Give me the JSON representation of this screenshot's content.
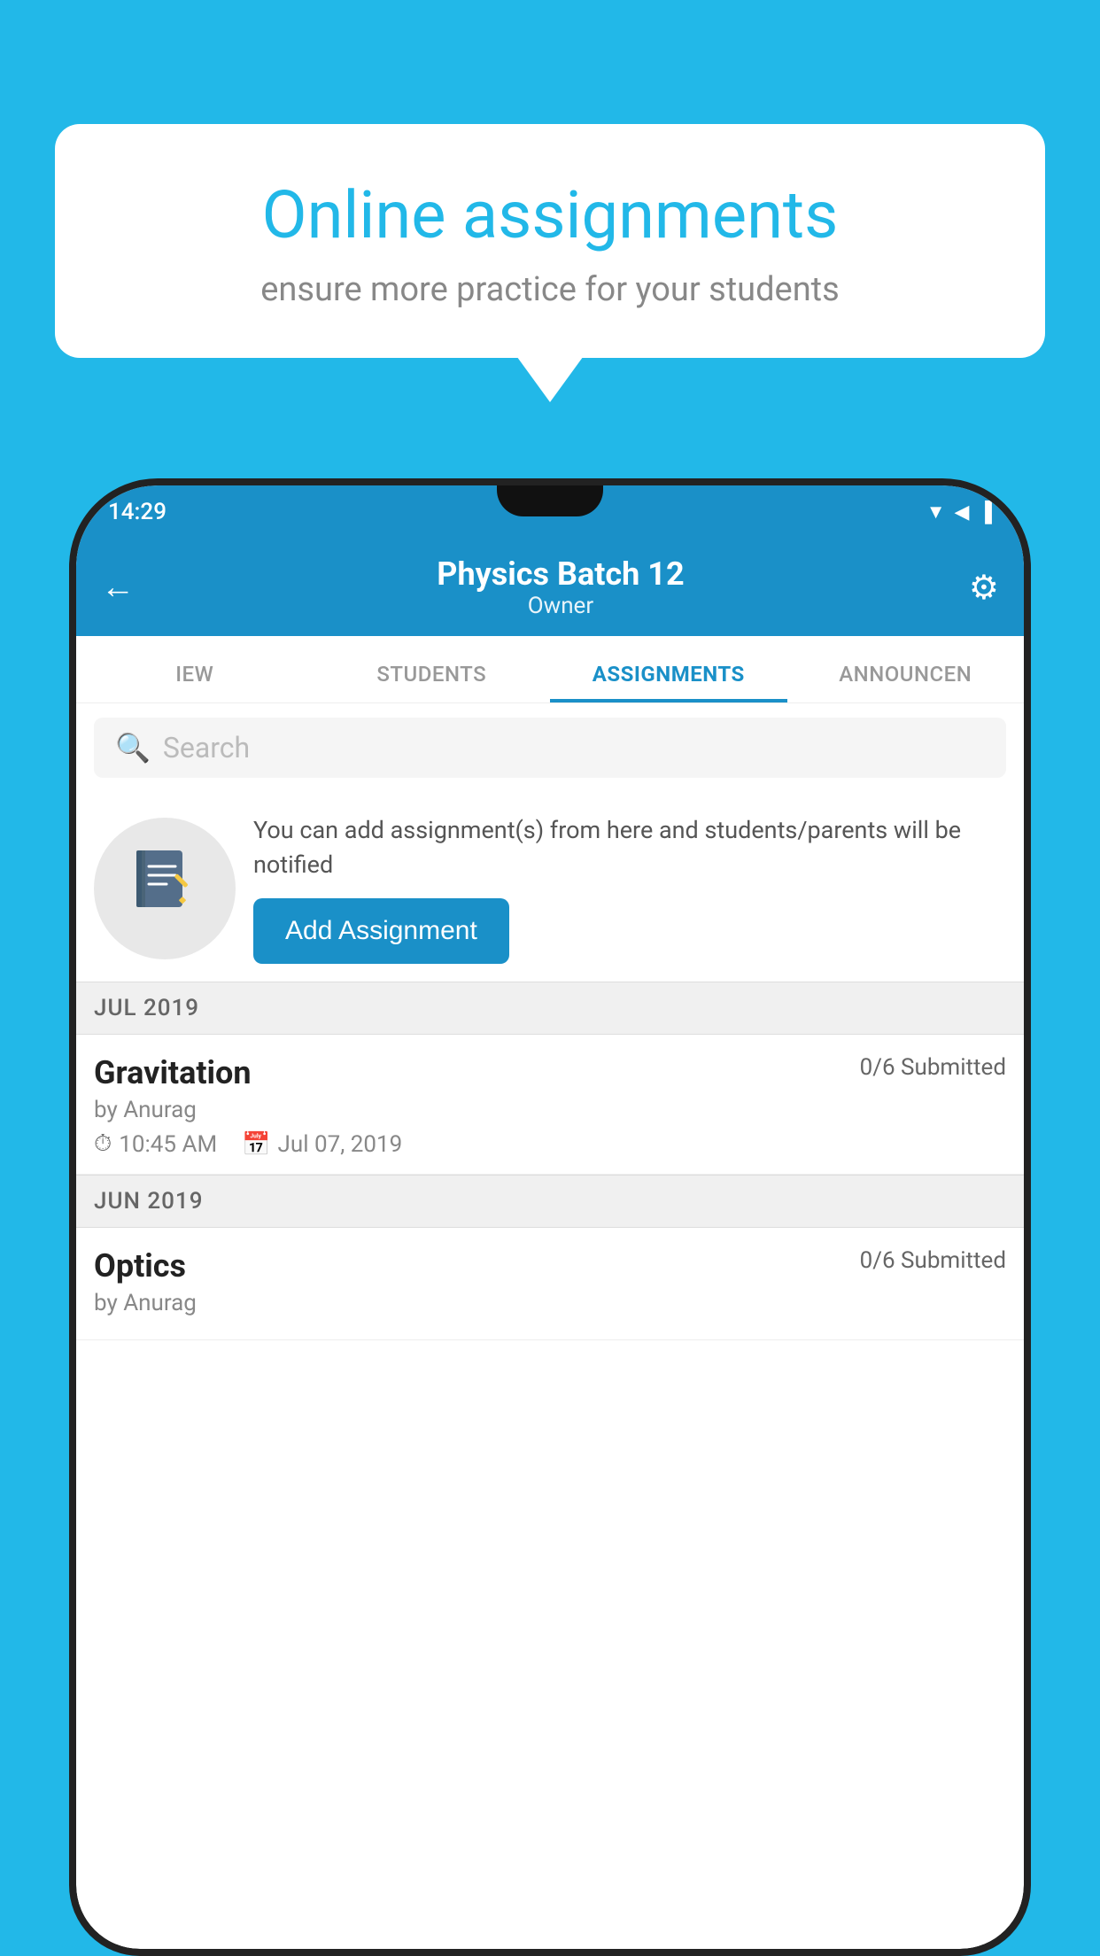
{
  "background": {
    "color": "#22b8e8"
  },
  "speech_bubble": {
    "title": "Online assignments",
    "subtitle": "ensure more practice for your students"
  },
  "status_bar": {
    "time": "14:29",
    "icons": "▼ ◀ ▐"
  },
  "app_header": {
    "title": "Physics Batch 12",
    "subtitle": "Owner",
    "back_label": "←",
    "gear_label": "⚙"
  },
  "tabs": [
    {
      "label": "IEW",
      "active": false
    },
    {
      "label": "STUDENTS",
      "active": false
    },
    {
      "label": "ASSIGNMENTS",
      "active": true
    },
    {
      "label": "ANNOUNCEN",
      "active": false
    }
  ],
  "search": {
    "placeholder": "Search"
  },
  "promo": {
    "icon": "📓",
    "description": "You can add assignment(s) from here and students/parents will be notified",
    "button_label": "Add Assignment"
  },
  "sections": [
    {
      "label": "JUL 2019",
      "assignments": [
        {
          "title": "Gravitation",
          "submitted": "0/6 Submitted",
          "by": "by Anurag",
          "time": "10:45 AM",
          "date": "Jul 07, 2019"
        }
      ]
    },
    {
      "label": "JUN 2019",
      "assignments": [
        {
          "title": "Optics",
          "submitted": "0/6 Submitted",
          "by": "by Anurag",
          "time": "",
          "date": ""
        }
      ]
    }
  ]
}
